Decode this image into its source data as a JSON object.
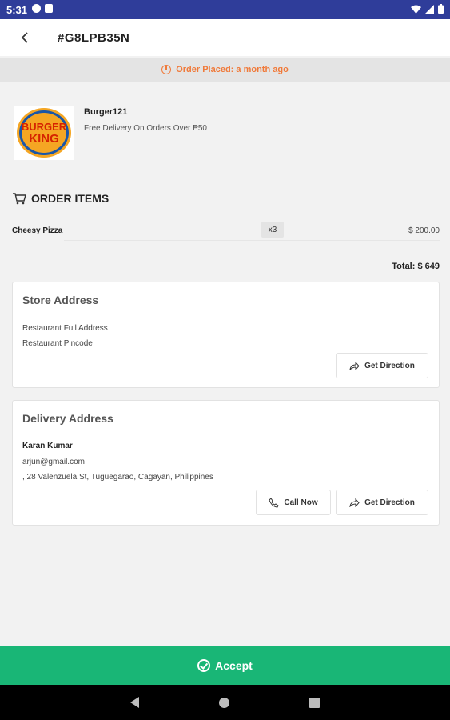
{
  "status_bar": {
    "time": "5:31"
  },
  "header": {
    "order_id": "#G8LPB35N"
  },
  "banner": {
    "text": "Order Placed: a month ago",
    "color": "#f07a3a"
  },
  "store": {
    "name": "Burger121",
    "subtitle": "Free Delivery On Orders Over ₱50",
    "logo_text_top": "BURGER",
    "logo_text_bottom": "KING"
  },
  "order_items": {
    "title": "ORDER ITEMS",
    "items": [
      {
        "name": "Cheesy Pizza",
        "qty": "x3",
        "price": "$ 200.00"
      }
    ],
    "total": "Total: $ 649"
  },
  "store_address": {
    "title": "Store Address",
    "line1": "Restaurant Full Address",
    "line2": "Restaurant Pincode",
    "direction_label": "Get Direction"
  },
  "delivery_address": {
    "title": "Delivery Address",
    "name": "Karan Kumar",
    "email": "arjun@gmail.com",
    "address": ", 28 Valenzuela St, Tuguegarao, Cagayan, Philippines",
    "call_label": "Call Now",
    "direction_label": "Get Direction"
  },
  "footer": {
    "accept_label": "Accept",
    "accent": "#19b676"
  }
}
